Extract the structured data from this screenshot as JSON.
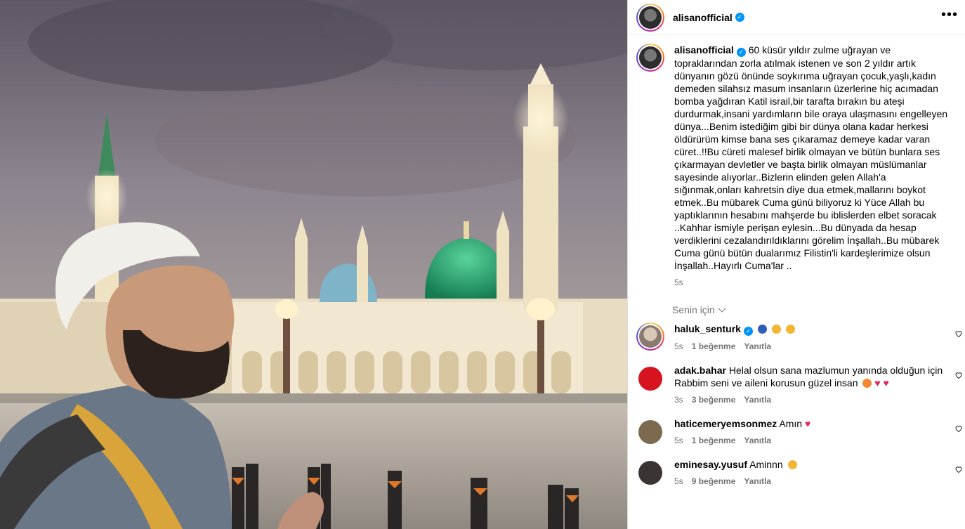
{
  "post": {
    "username": "alisanofficial",
    "more_icon": "more-horizontal-icon"
  },
  "caption": {
    "username": "alisanofficial",
    "text": "60 küsür yıldır zulme uğrayan ve topraklarından zorla atılmak istenen ve son 2 yıldır artık dünyanın gözü önünde soykırıma uğrayan çocuk,yaşlı,kadın demeden silahsız masum insanların üzerlerine hiç acımadan bomba yağdıran Katil israil,bir tarafta bırakın bu ateşi durdurmak,insani yardımların bile oraya ulaşmasını engelleyen dünya...Benim istediğim gibi bir dünya olana kadar herkesi öldürürüm kimse bana ses çıkaramaz demeye kadar varan cüret..!!Bu cüreti malesef birlik olmayan ve bütün bunlara ses çıkarmayan devletler ve başta birlik olmayan müslümanlar sayesinde alıyorlar..Bizlerin elinden gelen Allah'a sığınmak,onları kahretsin diye dua etmek,mallarını boykot etmek..Bu mübarek Cuma günü biliyoruz ki Yüce Allah bu yaptıklarının hesabını mahşerde bu iblislerden elbet soracak ..Kahhar ismiyle perişan eylesin...Bu dünyada da hesap verdiklerini cezalandırıldıklarını görelim İnşallah..Bu mübarek Cuma günü bütün dualarımız Filistin'li kardeşlerimize olsun İnşallah..Hayırlı Cuma'lar ..",
    "time": "5s"
  },
  "filter": {
    "label": "Senin için"
  },
  "comments": [
    {
      "username": "haluk_senturk",
      "verified": true,
      "text": "",
      "time": "5s",
      "likes": "1 beğenme",
      "reply": "Yanıtla"
    },
    {
      "username": "adak.bahar",
      "verified": false,
      "text": "Helal olsun sana mazlumun yanında olduğun için Rabbim seni ve aileni korusun güzel insan",
      "time": "3s",
      "likes": "3 beğenme",
      "reply": "Yanıtla"
    },
    {
      "username": "haticemeryemsonmez",
      "verified": false,
      "text": "Amın",
      "time": "5s",
      "likes": "1 beğenme",
      "reply": "Yanıtla"
    },
    {
      "username": "eminesay.yusuf",
      "verified": false,
      "text": "Aminnn",
      "time": "5s",
      "likes": "9 beğenme",
      "reply": "Yanıtla"
    }
  ],
  "colors": {
    "verified": "#0095f6",
    "secondary_text": "#737373",
    "heart": "#e0245e",
    "dome": "#1f9c6b"
  }
}
